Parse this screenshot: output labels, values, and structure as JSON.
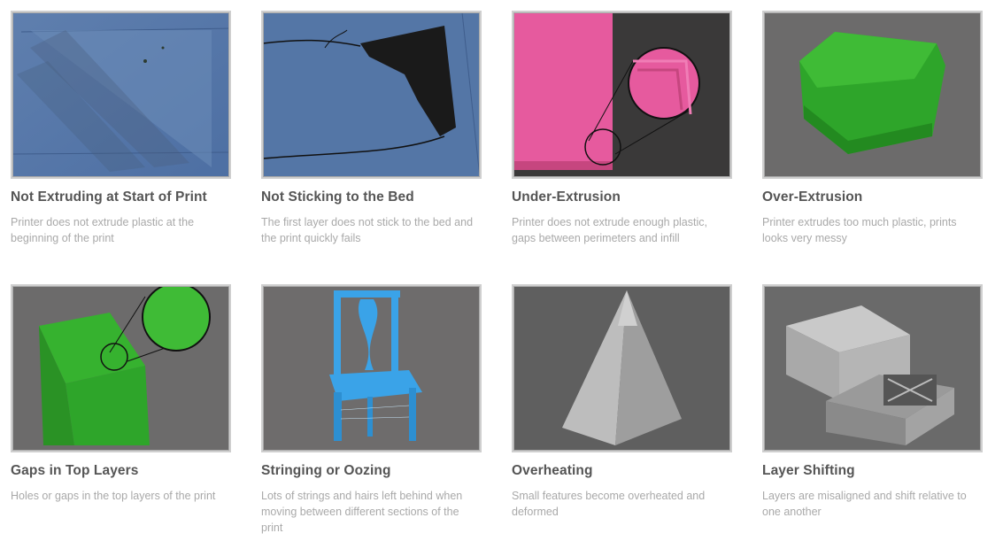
{
  "cards": [
    {
      "title": "Not Extruding at Start of Print",
      "desc": "Printer does not extrude plastic at the beginning of the print",
      "image": "blue-print-bed-faint-extrusion"
    },
    {
      "title": "Not Sticking to the Bed",
      "desc": "The first layer does not stick to the bed and the print quickly fails",
      "image": "black-first-layer-peeling"
    },
    {
      "title": "Under-Extrusion",
      "desc": "Printer does not extrude enough plastic, gaps between perimeters and infill",
      "image": "pink-print-corner-magnified"
    },
    {
      "title": "Over-Extrusion",
      "desc": "Printer extrudes too much plastic, prints looks very messy",
      "image": "green-messy-block"
    },
    {
      "title": "Gaps in Top Layers",
      "desc": "Holes or gaps in the top layers of the print",
      "image": "green-cube-magnified-top"
    },
    {
      "title": "Stringing or Oozing",
      "desc": "Lots of strings and hairs left behind when moving between different sections of the print",
      "image": "blue-chair-with-strings"
    },
    {
      "title": "Overheating",
      "desc": "Small features become overheated and deformed",
      "image": "gray-pyramid"
    },
    {
      "title": "Layer Shifting",
      "desc": "Layers are misaligned and shift relative to one another",
      "image": "gray-shifted-box"
    }
  ],
  "colors": {
    "title": "#555555",
    "desc": "#a9a9a9",
    "border": "#cfcfcf"
  }
}
